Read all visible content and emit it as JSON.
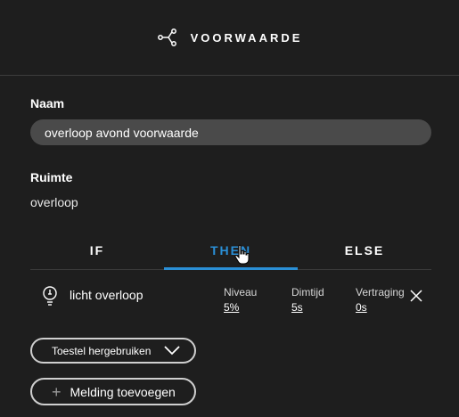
{
  "header": {
    "title": "VOORWAARDE",
    "icon": "share-nodes-icon"
  },
  "form": {
    "name_label": "Naam",
    "name_value": "overloop avond voorwaarde",
    "room_label": "Ruimte",
    "room_value": "overloop"
  },
  "tabs": [
    {
      "label": "IF",
      "active": false
    },
    {
      "label": "THEN",
      "active": true
    },
    {
      "label": "ELSE",
      "active": false
    }
  ],
  "action": {
    "icon": "lightbulb-icon",
    "device": "licht overloop",
    "params": [
      {
        "label": "Niveau",
        "value": "5%"
      },
      {
        "label": "Dimtijd",
        "value": "5s"
      },
      {
        "label": "Vertraging",
        "value": "0s"
      }
    ]
  },
  "buttons": {
    "reuse_label": "Toestel hergebruiken",
    "add_label": "Melding toevoegen"
  },
  "colors": {
    "accent": "#2a8fd6",
    "background": "#1e1e1e",
    "input_bg": "#4a4a4a"
  }
}
